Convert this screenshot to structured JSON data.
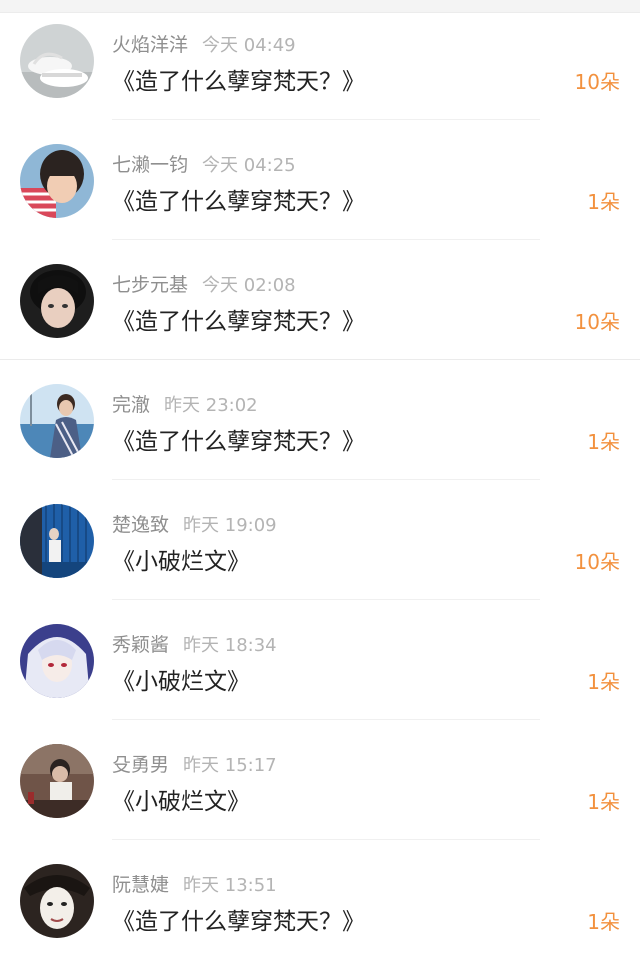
{
  "colors": {
    "username": "#8f8f8f",
    "time": "#b4b4b4",
    "book": "#222222",
    "count": "#f2913e"
  },
  "rows": [
    {
      "username": "火焰洋洋",
      "time": "今天 04:49",
      "book": "《造了什么孽穿梵天？》",
      "count": "10朵",
      "avatar_icon": "sneakers-avatar-icon"
    },
    {
      "username": "七濑一钧",
      "time": "今天 04:25",
      "book": "《造了什么孽穿梵天？》",
      "count": "1朵",
      "avatar_icon": "child-avatar-icon"
    },
    {
      "username": "七步元基",
      "time": "今天 02:08",
      "book": "《造了什么孽穿梵天？》",
      "count": "10朵",
      "avatar_icon": "portrait-avatar-icon"
    },
    {
      "username": "完澈",
      "time": "昨天 23:02",
      "book": "《造了什么孽穿梵天？》",
      "count": "1朵",
      "avatar_icon": "seaside-avatar-icon"
    },
    {
      "username": "楚逸致",
      "time": "昨天 19:09",
      "book": "《小破烂文》",
      "count": "10朵",
      "avatar_icon": "blue-wall-avatar-icon"
    },
    {
      "username": "秀颖酱",
      "time": "昨天 18:34",
      "book": "《小破烂文》",
      "count": "1朵",
      "avatar_icon": "anime-avatar-icon"
    },
    {
      "username": "殳勇男",
      "time": "昨天 15:17",
      "book": "《小破烂文》",
      "count": "1朵",
      "avatar_icon": "street-avatar-icon"
    },
    {
      "username": "阮慧婕",
      "time": "昨天 13:51",
      "book": "《造了什么孽穿梵天？》",
      "count": "1朵",
      "avatar_icon": "masked-face-avatar-icon"
    }
  ]
}
